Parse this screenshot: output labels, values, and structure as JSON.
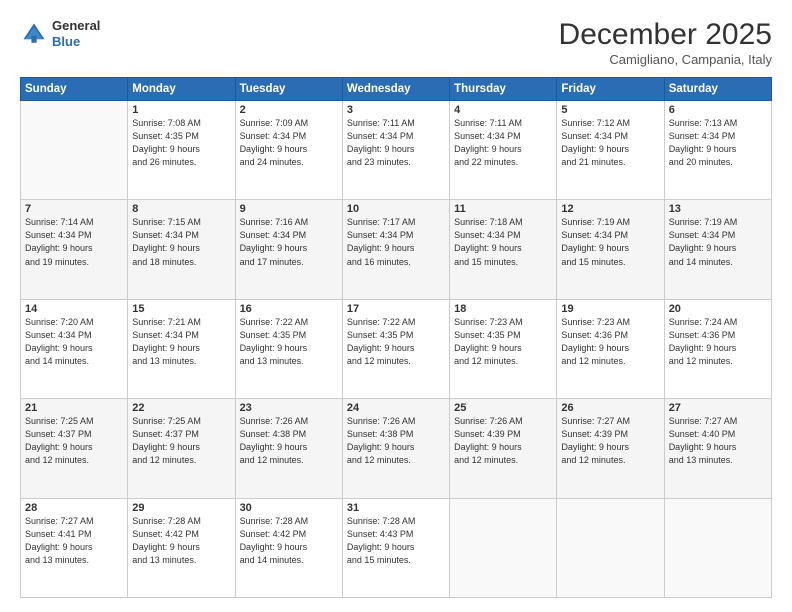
{
  "logo": {
    "general": "General",
    "blue": "Blue"
  },
  "title": "December 2025",
  "location": "Camigliano, Campania, Italy",
  "days_of_week": [
    "Sunday",
    "Monday",
    "Tuesday",
    "Wednesday",
    "Thursday",
    "Friday",
    "Saturday"
  ],
  "weeks": [
    [
      {
        "day": "",
        "info": ""
      },
      {
        "day": "1",
        "info": "Sunrise: 7:08 AM\nSunset: 4:35 PM\nDaylight: 9 hours\nand 26 minutes."
      },
      {
        "day": "2",
        "info": "Sunrise: 7:09 AM\nSunset: 4:34 PM\nDaylight: 9 hours\nand 24 minutes."
      },
      {
        "day": "3",
        "info": "Sunrise: 7:11 AM\nSunset: 4:34 PM\nDaylight: 9 hours\nand 23 minutes."
      },
      {
        "day": "4",
        "info": "Sunrise: 7:11 AM\nSunset: 4:34 PM\nDaylight: 9 hours\nand 22 minutes."
      },
      {
        "day": "5",
        "info": "Sunrise: 7:12 AM\nSunset: 4:34 PM\nDaylight: 9 hours\nand 21 minutes."
      },
      {
        "day": "6",
        "info": "Sunrise: 7:13 AM\nSunset: 4:34 PM\nDaylight: 9 hours\nand 20 minutes."
      }
    ],
    [
      {
        "day": "7",
        "info": "Sunrise: 7:14 AM\nSunset: 4:34 PM\nDaylight: 9 hours\nand 19 minutes."
      },
      {
        "day": "8",
        "info": "Sunrise: 7:15 AM\nSunset: 4:34 PM\nDaylight: 9 hours\nand 18 minutes."
      },
      {
        "day": "9",
        "info": "Sunrise: 7:16 AM\nSunset: 4:34 PM\nDaylight: 9 hours\nand 17 minutes."
      },
      {
        "day": "10",
        "info": "Sunrise: 7:17 AM\nSunset: 4:34 PM\nDaylight: 9 hours\nand 16 minutes."
      },
      {
        "day": "11",
        "info": "Sunrise: 7:18 AM\nSunset: 4:34 PM\nDaylight: 9 hours\nand 15 minutes."
      },
      {
        "day": "12",
        "info": "Sunrise: 7:19 AM\nSunset: 4:34 PM\nDaylight: 9 hours\nand 15 minutes."
      },
      {
        "day": "13",
        "info": "Sunrise: 7:19 AM\nSunset: 4:34 PM\nDaylight: 9 hours\nand 14 minutes."
      }
    ],
    [
      {
        "day": "14",
        "info": "Sunrise: 7:20 AM\nSunset: 4:34 PM\nDaylight: 9 hours\nand 14 minutes."
      },
      {
        "day": "15",
        "info": "Sunrise: 7:21 AM\nSunset: 4:34 PM\nDaylight: 9 hours\nand 13 minutes."
      },
      {
        "day": "16",
        "info": "Sunrise: 7:22 AM\nSunset: 4:35 PM\nDaylight: 9 hours\nand 13 minutes."
      },
      {
        "day": "17",
        "info": "Sunrise: 7:22 AM\nSunset: 4:35 PM\nDaylight: 9 hours\nand 12 minutes."
      },
      {
        "day": "18",
        "info": "Sunrise: 7:23 AM\nSunset: 4:35 PM\nDaylight: 9 hours\nand 12 minutes."
      },
      {
        "day": "19",
        "info": "Sunrise: 7:23 AM\nSunset: 4:36 PM\nDaylight: 9 hours\nand 12 minutes."
      },
      {
        "day": "20",
        "info": "Sunrise: 7:24 AM\nSunset: 4:36 PM\nDaylight: 9 hours\nand 12 minutes."
      }
    ],
    [
      {
        "day": "21",
        "info": "Sunrise: 7:25 AM\nSunset: 4:37 PM\nDaylight: 9 hours\nand 12 minutes."
      },
      {
        "day": "22",
        "info": "Sunrise: 7:25 AM\nSunset: 4:37 PM\nDaylight: 9 hours\nand 12 minutes."
      },
      {
        "day": "23",
        "info": "Sunrise: 7:26 AM\nSunset: 4:38 PM\nDaylight: 9 hours\nand 12 minutes."
      },
      {
        "day": "24",
        "info": "Sunrise: 7:26 AM\nSunset: 4:38 PM\nDaylight: 9 hours\nand 12 minutes."
      },
      {
        "day": "25",
        "info": "Sunrise: 7:26 AM\nSunset: 4:39 PM\nDaylight: 9 hours\nand 12 minutes."
      },
      {
        "day": "26",
        "info": "Sunrise: 7:27 AM\nSunset: 4:39 PM\nDaylight: 9 hours\nand 12 minutes."
      },
      {
        "day": "27",
        "info": "Sunrise: 7:27 AM\nSunset: 4:40 PM\nDaylight: 9 hours\nand 13 minutes."
      }
    ],
    [
      {
        "day": "28",
        "info": "Sunrise: 7:27 AM\nSunset: 4:41 PM\nDaylight: 9 hours\nand 13 minutes."
      },
      {
        "day": "29",
        "info": "Sunrise: 7:28 AM\nSunset: 4:42 PM\nDaylight: 9 hours\nand 13 minutes."
      },
      {
        "day": "30",
        "info": "Sunrise: 7:28 AM\nSunset: 4:42 PM\nDaylight: 9 hours\nand 14 minutes."
      },
      {
        "day": "31",
        "info": "Sunrise: 7:28 AM\nSunset: 4:43 PM\nDaylight: 9 hours\nand 15 minutes."
      },
      {
        "day": "",
        "info": ""
      },
      {
        "day": "",
        "info": ""
      },
      {
        "day": "",
        "info": ""
      }
    ]
  ]
}
